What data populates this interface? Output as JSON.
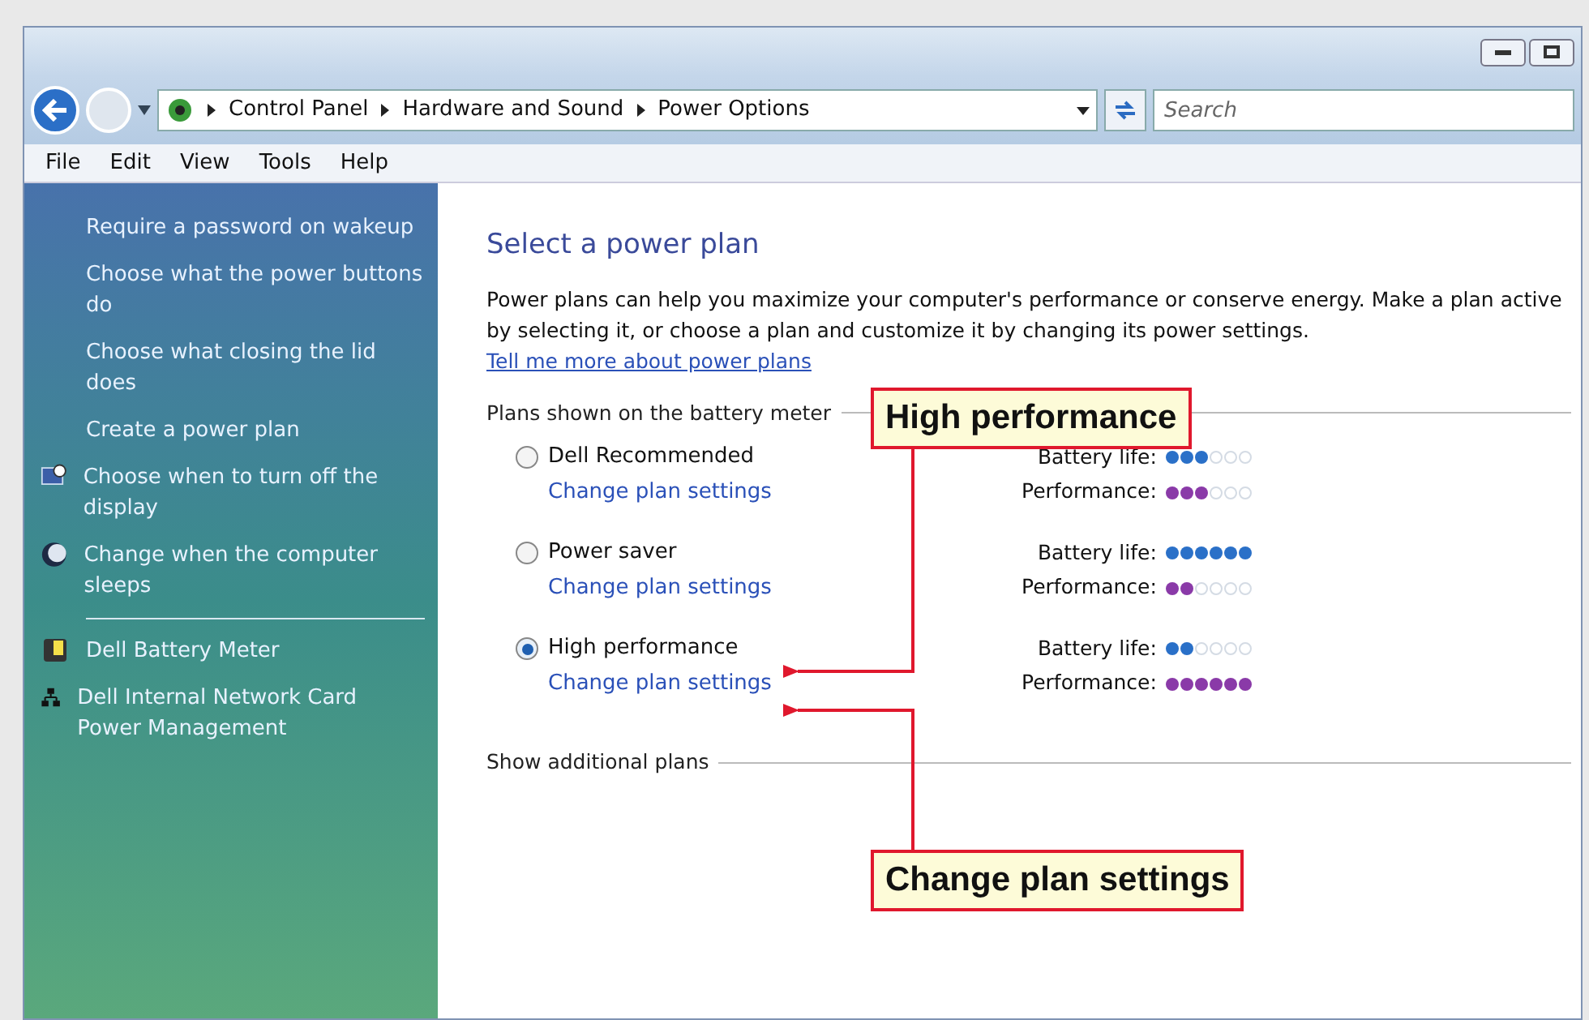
{
  "address_bar": {
    "crumbs": [
      "Control Panel",
      "Hardware and Sound",
      "Power Options"
    ]
  },
  "search": {
    "placeholder": "Search"
  },
  "menu": [
    "File",
    "Edit",
    "View",
    "Tools",
    "Help"
  ],
  "sidebar": {
    "tasks": [
      "Require a password on wakeup",
      "Choose what the power buttons do",
      "Choose what closing the lid does",
      "Create a power plan"
    ],
    "icon_tasks": [
      {
        "kind": "display",
        "label": "Choose when to turn off the display"
      },
      {
        "kind": "sleep",
        "label": "Change when the computer sleeps"
      }
    ],
    "see_also": [
      {
        "kind": "battery",
        "label": "Dell Battery Meter"
      },
      {
        "kind": "network",
        "label": "Dell Internal Network Card Power Management"
      }
    ]
  },
  "content": {
    "title": "Select a power plan",
    "description": "Power plans can help you maximize your computer's performance or conserve energy. Make a plan active by selecting it, or choose a plan and customize it by changing its power settings.",
    "link": "Tell me more about power plans",
    "plans_heading": "Plans shown on the battery meter",
    "plans": [
      {
        "name": "Dell Recommended",
        "selected": false,
        "settings_link": "Change plan settings",
        "battery_label": "Battery life:",
        "battery": {
          "stars": 3
        },
        "performance_label": "Performance:",
        "performance": {
          "stars": 3
        }
      },
      {
        "name": "Power saver",
        "selected": false,
        "settings_link": "Change plan settings",
        "battery_label": "Battery life:",
        "battery": {
          "stars": 6
        },
        "performance_label": "Performance:",
        "performance": {
          "stars": 2
        }
      },
      {
        "name": "High performance",
        "selected": true,
        "settings_link": "Change plan settings",
        "battery_label": "Battery life:",
        "battery": {
          "stars": 2
        },
        "performance_label": "Performance:",
        "performance": {
          "stars": 6
        }
      }
    ],
    "more_plans": "Show additional plans"
  },
  "callouts": [
    "High performance",
    "Change plan settings"
  ]
}
